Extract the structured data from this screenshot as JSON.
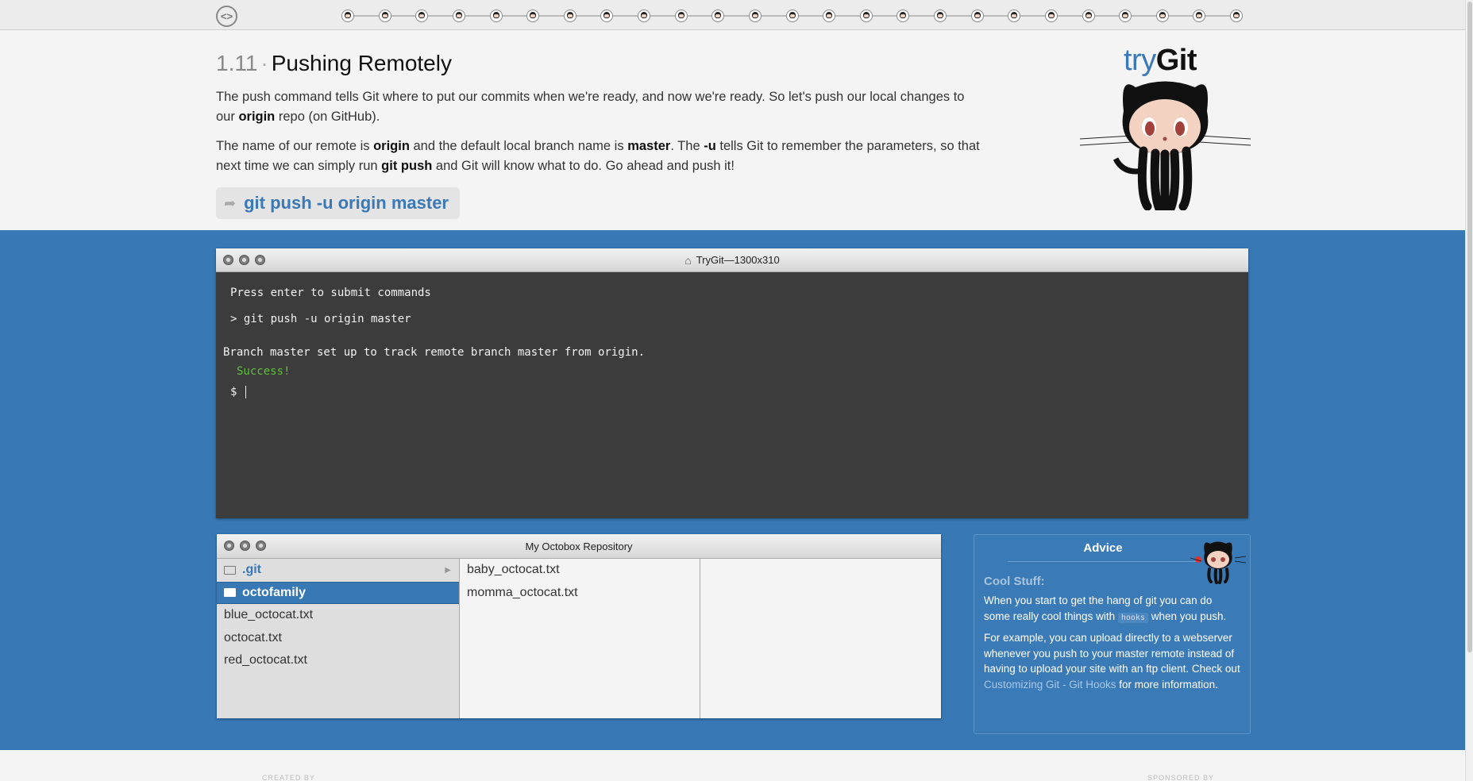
{
  "nav": {
    "home_icon": "code-circle-icon",
    "progress_steps": 25
  },
  "lesson": {
    "number": "1.11",
    "separator": "·",
    "title": "Pushing Remotely",
    "p1_a": "The push command tells Git where to put our commits when we're ready, and now we're ready. So let's push our local changes to our ",
    "p1_b": "origin",
    "p1_c": " repo (on GitHub).",
    "p2_a": "The name of our remote is ",
    "p2_b": "origin",
    "p2_c": " and the default local branch name is ",
    "p2_d": "master",
    "p2_e": ". The ",
    "p2_f": "-u",
    "p2_g": " tells Git to remember the parameters, so that next time we can simply run ",
    "p2_h": "git push",
    "p2_i": " and Git will know what to do. Go ahead and push it!",
    "command": "git push -u origin master"
  },
  "logo": {
    "try": "try",
    "git": "Git"
  },
  "terminal": {
    "title": "TryGit—1300x310",
    "lines": {
      "intro": "Press enter to submit commands",
      "cmd": "> git push -u origin master",
      "output": "Branch master set up to track remote branch master from origin.",
      "success": "Success!",
      "prompt": "$ "
    }
  },
  "octobox": {
    "title": "My Octobox Repository",
    "col1": [
      ".git",
      "octofamily",
      "blue_octocat.txt",
      "octocat.txt",
      "red_octocat.txt"
    ],
    "col2": [
      "baby_octocat.txt",
      "momma_octocat.txt"
    ]
  },
  "advice": {
    "title": "Advice",
    "subtitle": "Cool Stuff:",
    "p1_a": "When you start to get the hang of git you can do some really cool things with ",
    "p1_code": "hooks",
    "p1_b": " when you push.",
    "p2_a": "For example, you can upload directly to a webserver whenever you push to your master remote instead of having to upload your site with an ftp client. Check out ",
    "p2_link": "Customizing Git - Git Hooks",
    "p2_b": " for more information."
  },
  "footer": {
    "left": "CREATED BY",
    "right": "SPONSORED BY"
  },
  "colors": {
    "accent": "#3878b5",
    "success": "#5fbf3f",
    "terminal_bg": "#3c3c3c"
  }
}
